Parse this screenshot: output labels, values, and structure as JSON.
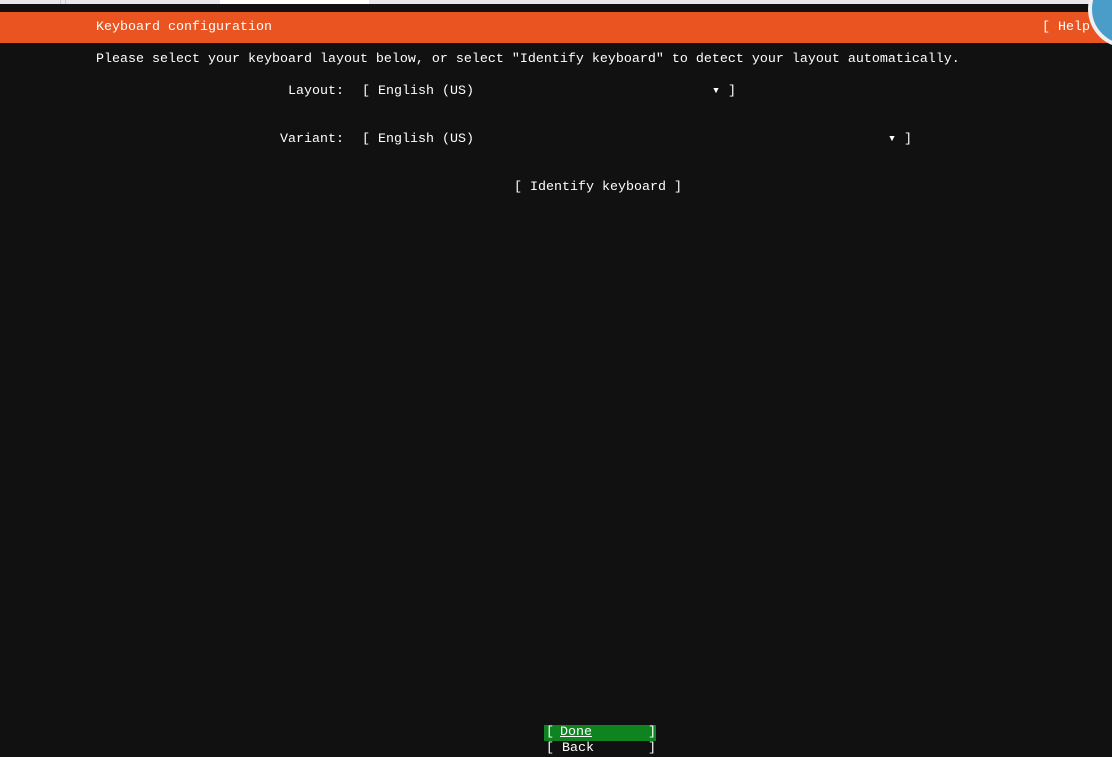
{
  "header": {
    "title": "Keyboard configuration",
    "help": "[ Help"
  },
  "instructions": "Please select your keyboard layout below, or select \"Identify keyboard\" to detect your layout automatically.",
  "layout": {
    "label": "Layout:",
    "value": "[ English (US)",
    "arrow": "▾ ]"
  },
  "variant": {
    "label": "Variant:",
    "value": "[ English (US)",
    "arrow": "▾ ]"
  },
  "identify_button": "[ Identify keyboard ]",
  "buttons": {
    "done_open": "[ ",
    "done": "Done",
    "done_close": "]",
    "back": "[ Back",
    "back_close": "]"
  },
  "colors": {
    "header": "#e95420",
    "done": "#0e8420",
    "background": "#111111"
  }
}
